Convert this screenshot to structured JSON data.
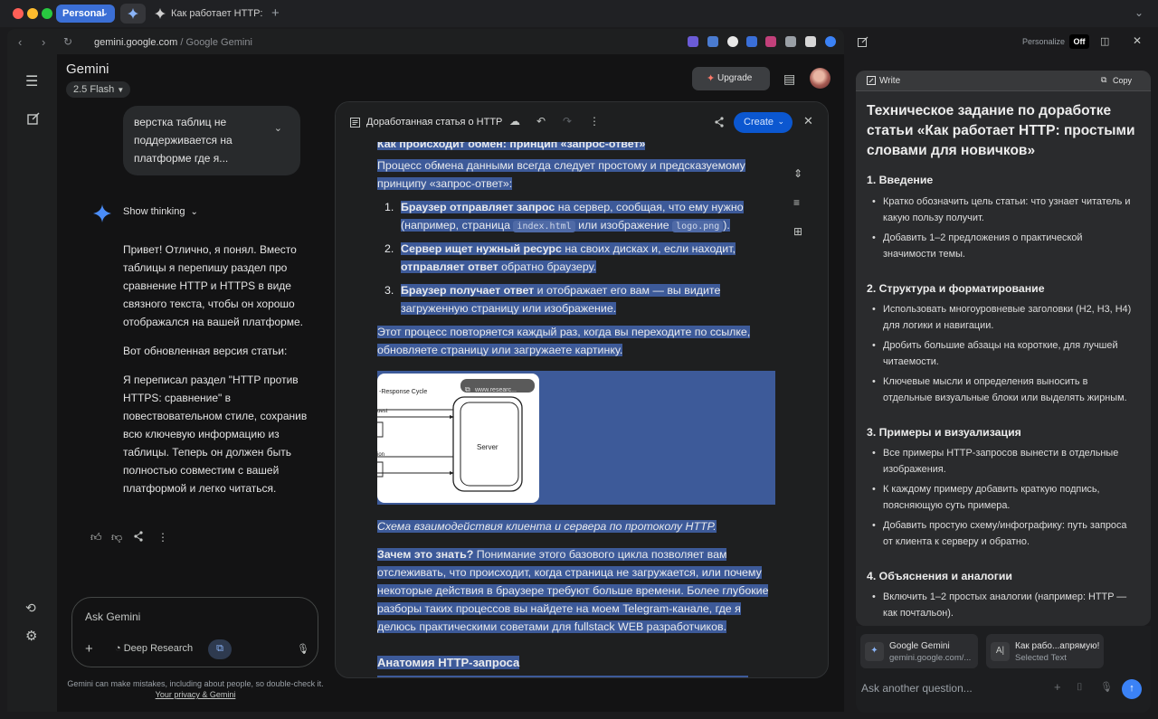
{
  "browser": {
    "profile_label": "Personal",
    "tab_title": "Как работает HTTP: пр",
    "url_domain": "gemini.google.com",
    "url_path": "/ Google Gemini"
  },
  "gemini": {
    "app_title": "Gemini",
    "model": "2.5 Flash",
    "upgrade_label": "Upgrade",
    "user_message": "верстка таблиц не поддерживается на платформе где я...",
    "show_thinking_label": "Show thinking",
    "response_p1": "Привет! Отлично, я понял. Вместо таблицы я перепишу раздел про сравнение HTTP и HTTPS в виде связного текста, чтобы он хорошо отображался на вашей платформе.",
    "response_p2": "Вот обновленная версия статьи:",
    "response_p3": "Я переписал раздел \"HTTP против HTTPS: сравнение\" в повествовательном стиле, сохранив всю ключевую информацию из таблицы. Теперь он должен быть полностью совместим с вашей платформой и легко читаться.",
    "ask_placeholder": "Ask Gemini",
    "deep_research_label": "Deep Research",
    "disclaimer_text": "Gemini can make mistakes, including about people, so double-check it.",
    "privacy_link": "Your privacy & Gemini"
  },
  "doc": {
    "title": "Доработанная статья о HTTP",
    "create_label": "Create",
    "heading_cut": "Как происходит обмен: принцип «запрос-ответ»",
    "intro": "Процесс обмена данными всегда следует простому и предсказуемому принципу «запрос-ответ»:",
    "list": [
      {
        "num": "1.",
        "bold": "Браузер отправляет запрос",
        "text_a": " на сервер, сообщая, что ему нужно (например, страница ",
        "code1": "index.html",
        "text_b": " или изображение ",
        "code2": "logo.png",
        "text_c": ")."
      },
      {
        "num": "2.",
        "bold": "Сервер ищет нужный ресурс",
        "text_a": " на своих дисках и, если находит, ",
        "bold2": "отправляет ответ",
        "text_b": " обратно браузеру."
      },
      {
        "num": "3.",
        "bold": "Браузер получает ответ",
        "text_a": " и отображает его вам — вы видите загруженную страницу или изображение."
      }
    ],
    "repeat_text": "Этот процесс повторяется каждый раз, когда вы переходите по ссылке, обновляете страницу или загружаете картинку.",
    "image": {
      "title": "-Response Cycle",
      "badge": "www.researc...",
      "server_label": "Server",
      "label_1": "uest",
      "label_2": "ion"
    },
    "caption": "Схема взаимодействия клиента и сервера по протоколу HTTP.",
    "why_bold": "Зачем это знать?",
    "why_text": " Понимание этого базового цикла позволяет вам отслеживать, что происходит, когда страница не загружается, или почему некоторые действия в браузере требуют больше времени. Более глубокие разборы таких процессов вы найдете на моем Telegram-канале, где я делюсь практическими советами для fullstack WEB разработчиков.",
    "next_heading": "Анатомия HTTP-запроса"
  },
  "sidebar": {
    "personalize_label": "Personalize",
    "toggle_state": "Off",
    "write_label": "Write",
    "copy_label": "Copy",
    "title": "Техническое задание по доработке статьи «Как работает HTTP: простыми словами для новичков»",
    "sections": [
      {
        "heading": "1. Введение",
        "bullets": [
          "Кратко обозначить цель статьи: что узнает читатель и какую пользу получит.",
          "Добавить 1–2 предложения о практической значимости темы."
        ]
      },
      {
        "heading": "2. Структура и форматирование",
        "bullets": [
          "Использовать многоуровневые заголовки (H2, H3, H4) для логики и навигации.",
          "Дробить большие абзацы на короткие, для лучшей читаемости.",
          "Ключевые мысли и определения выносить в отдельные визуальные блоки или выделять жирным."
        ]
      },
      {
        "heading": "3. Примеры и визуализация",
        "bullets": [
          "Все примеры HTTP-запросов вынести в отдельные изображения.",
          "К каждому примеру добавить краткую подпись, поясняющую суть примера.",
          "Добавить простую схему/инфографику: путь запроса от клиента к серверу и обратно."
        ]
      },
      {
        "heading": "4. Объяснения и аналогии",
        "bullets": [
          "Включить 1–2 простых аналогии (например: HTTP — как почтальон)."
        ]
      }
    ],
    "chip1_title": "Google Gemini",
    "chip1_sub": "gemini.google.com/...",
    "chip2_title": "Как рабо...апрямую!",
    "chip2_sub": "Selected Text",
    "ask_placeholder": "Ask another question..."
  },
  "colors": {
    "accent": "#0b57d0",
    "selection": "#3d5a99",
    "profile": "#3b6fd6",
    "send": "#3b82f6"
  }
}
